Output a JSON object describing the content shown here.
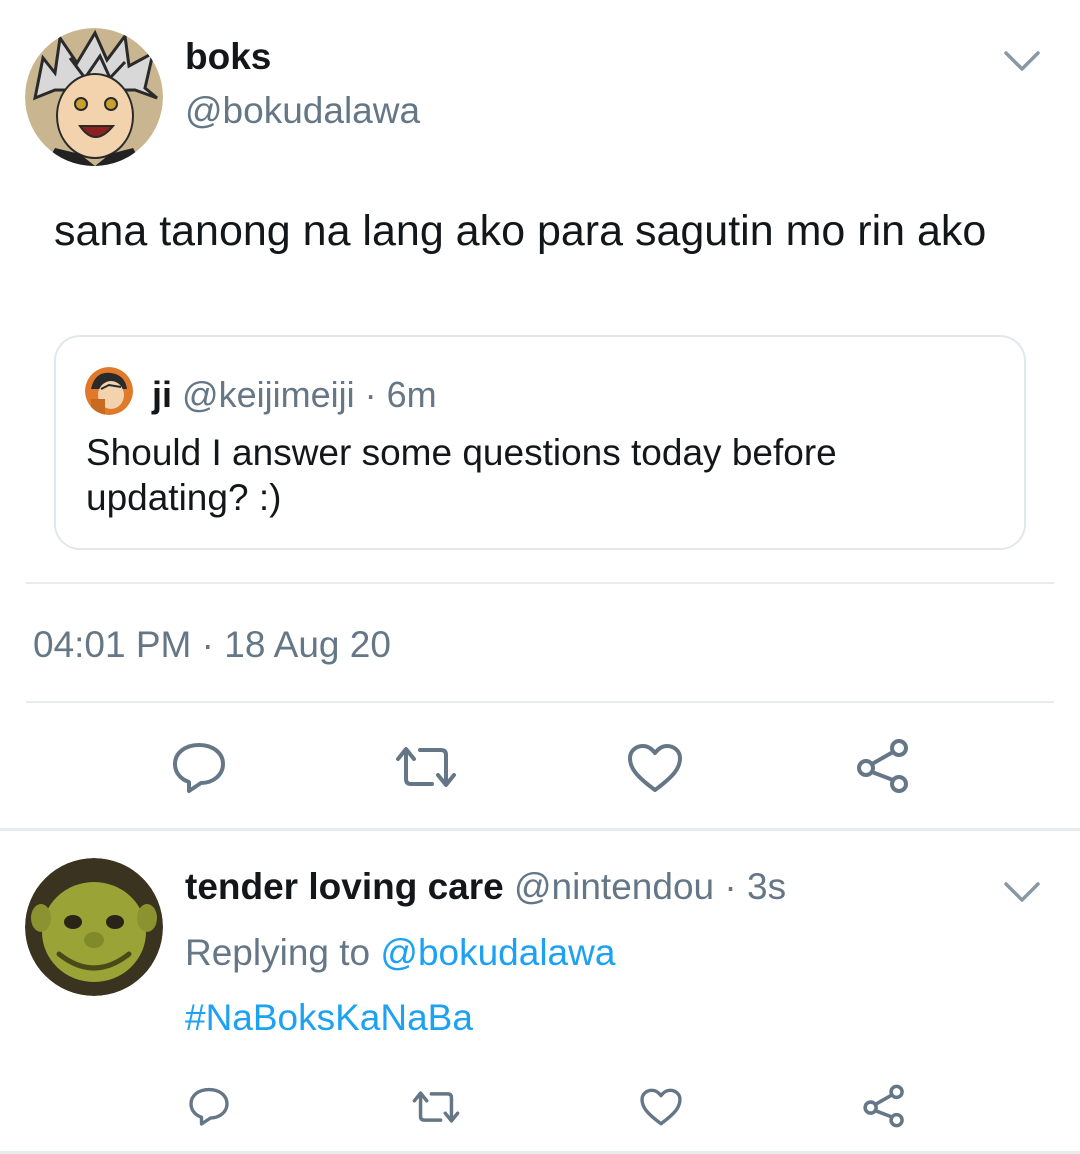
{
  "main_tweet": {
    "display_name": "boks",
    "handle": "@bokudalawa",
    "text": "sana tanong na lang ako para sagutin mo rin ako",
    "timestamp": "04:01 PM · 18 Aug 20",
    "quoted": {
      "display_name": "ji",
      "handle": "@keijimeiji",
      "separator": "·",
      "time": "6m",
      "text": "Should I answer some questions today before updating? :)"
    }
  },
  "reply_tweet": {
    "display_name": "tender loving care",
    "handle": "@nintendou",
    "separator": "·",
    "time": "3s",
    "replying_prefix": "Replying to",
    "replying_handle": "@bokudalawa",
    "hashtag": "#NaBoksKaNaBa"
  },
  "colors": {
    "link": "#1da1f2",
    "muted": "#657786",
    "divider": "#e6ecf0"
  },
  "icons": [
    "chevron-down-icon",
    "reply-icon",
    "retweet-icon",
    "like-icon",
    "share-icon"
  ]
}
